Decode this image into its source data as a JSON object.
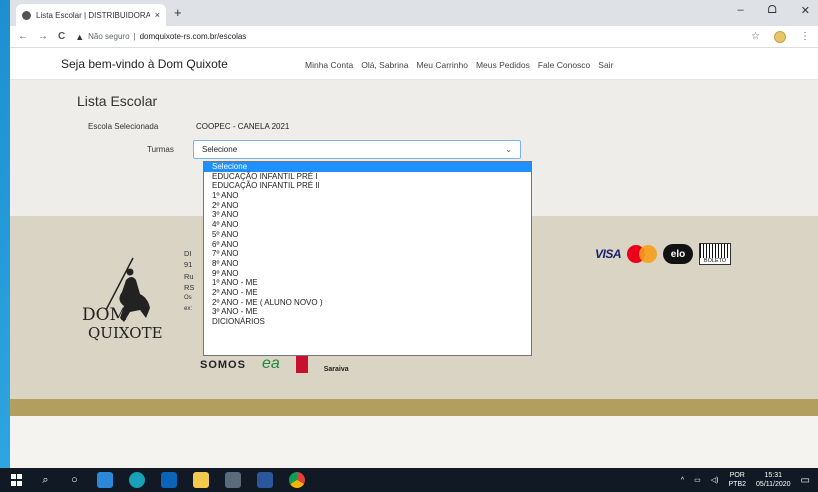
{
  "browser": {
    "tab_title": "Lista Escolar | DISTRIBUIDORA D",
    "tab_close": "×",
    "new_tab": "+",
    "controls": {
      "minimize": "–",
      "maximize": "ᗝ",
      "close": "✕"
    },
    "nav_back": "←",
    "nav_forward": "→",
    "nav_reload": "C",
    "security_warning": "Não seguro",
    "url_separator": "|",
    "url": "domquixote-rs.com.br/escolas",
    "star": "☆",
    "menu": "⋮"
  },
  "site_header": {
    "welcome": "Seja bem-vindo à Dom Quixote",
    "nav": [
      "Minha Conta",
      "Olá, Sabrina",
      "Meu Carrinho",
      "Meus Pedidos",
      "Fale Conosco",
      "Sair"
    ]
  },
  "main": {
    "title": "Lista Escolar",
    "escola_label": "Escola Selecionada",
    "escola_value": "COOPEC - CANELA 2021",
    "turmas_label": "Turmas",
    "turmas_selected": "Selecione",
    "select_chevron": "⌄"
  },
  "dropdown": {
    "options": [
      "Selecione",
      "EDUCAÇÃO INFANTIL PRÉ I",
      "EDUCAÇÃO INFANTIL PRÉ II",
      "1º ANO",
      "2º ANO",
      "3º ANO",
      "4º ANO",
      "5º ANO",
      "6º ANO",
      "7º ANO",
      "8º ANO",
      "9º ANO",
      "1º ANO - ME",
      "2º ANO - ME",
      "2º ANO - ME ( ALUNO NOVO )",
      "3º ANO - ME",
      "DICIONÁRIOS"
    ],
    "selected_index": 0
  },
  "footer": {
    "address_lines": [
      "DI",
      "91",
      "Ru",
      "RS",
      "Os",
      "ex:"
    ],
    "payments": {
      "visa": "VISA",
      "elo": "elo",
      "boleto": "BOLETO"
    },
    "partners": {
      "somos": "SOMOS",
      "ea": "ea",
      "saraiva": "Saraiva"
    }
  },
  "taskbar": {
    "search": "⌕",
    "task_view": "○",
    "tray_up": "^",
    "lang": "POR",
    "lang_sub": "PTB2",
    "time": "15:31",
    "date": "05/11/2020",
    "notifications": "▭"
  },
  "colors": {
    "main_bg": "#efedea",
    "footer_bg": "#d9d4c4",
    "gold_bar": "#b29e5e",
    "selected_option": "#1e90ff"
  }
}
